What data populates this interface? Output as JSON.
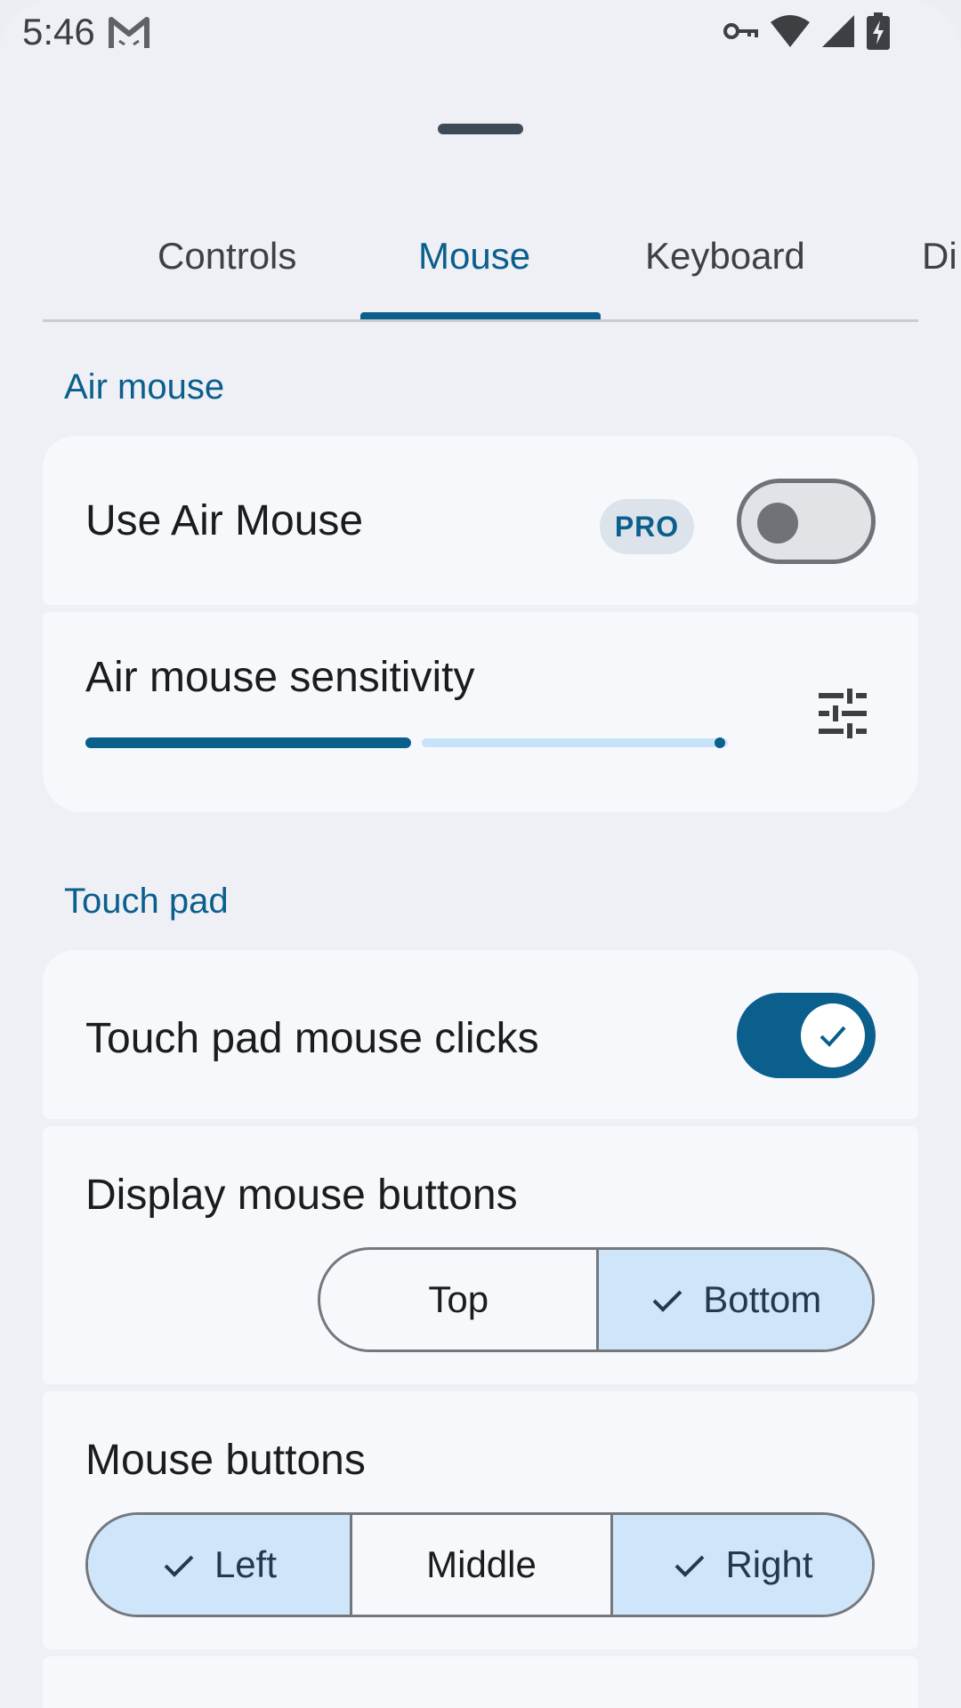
{
  "status_bar": {
    "time": "5:46"
  },
  "tabs": [
    {
      "label": "Controls"
    },
    {
      "label": "Mouse"
    },
    {
      "label": "Keyboard"
    },
    {
      "label": "Di"
    }
  ],
  "selected_tab": "Mouse",
  "air_mouse": {
    "section_title": "Air mouse",
    "use_air_mouse": {
      "label": "Use Air Mouse",
      "badge": "PRO",
      "enabled": false
    },
    "sensitivity": {
      "label": "Air mouse sensitivity",
      "value_fraction": 0.52
    }
  },
  "touch_pad": {
    "section_title": "Touch pad",
    "mouse_clicks": {
      "label": "Touch pad mouse clicks",
      "enabled": true
    },
    "display_buttons": {
      "label": "Display mouse buttons",
      "options": [
        "Top",
        "Bottom"
      ],
      "selected": "Bottom"
    },
    "mouse_buttons": {
      "label": "Mouse buttons",
      "options": [
        "Left",
        "Middle",
        "Right"
      ],
      "selected": [
        "Left",
        "Right"
      ]
    }
  },
  "colors": {
    "accent": "#0B5F8D",
    "selected_segment": "#CFE5FA",
    "background": "#EEF0F5",
    "card": "#F7F8FC"
  },
  "icons": [
    "gmail-icon",
    "vpn-key-icon",
    "wifi-icon",
    "cellular-icon",
    "battery-charging-icon",
    "tune-icon",
    "check-icon"
  ]
}
